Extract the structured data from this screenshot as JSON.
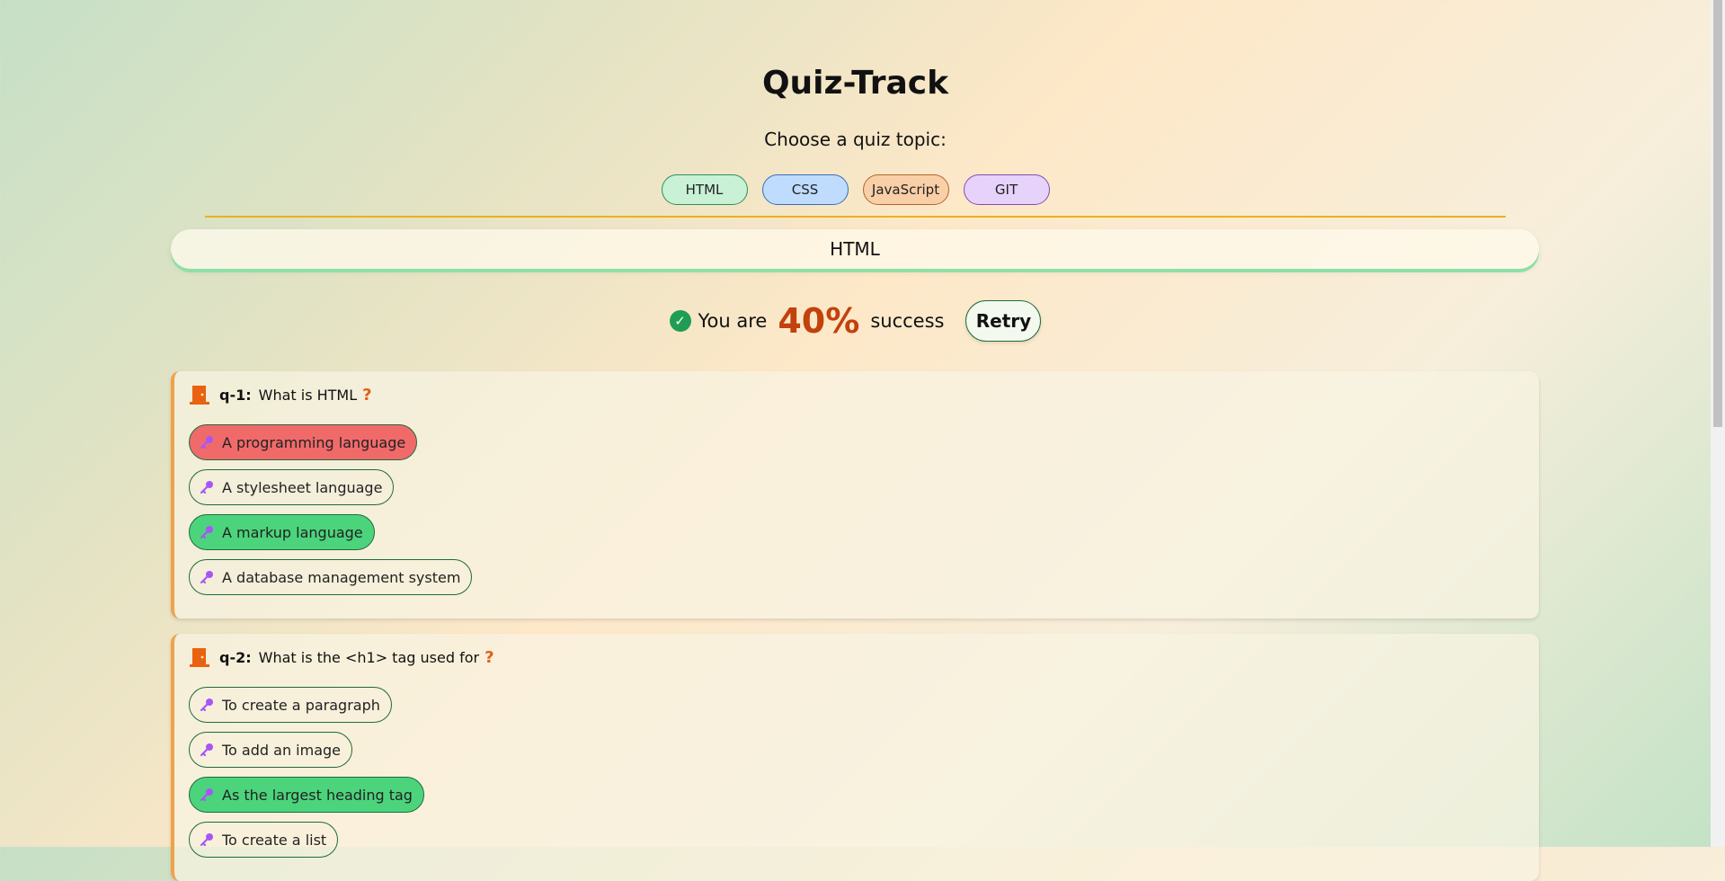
{
  "app": {
    "title": "Quiz-Track",
    "subtitle": "Choose a quiz topic:"
  },
  "topics": [
    {
      "label": "HTML"
    },
    {
      "label": "CSS"
    },
    {
      "label": "JavaScript"
    },
    {
      "label": "GIT"
    }
  ],
  "current_topic": "HTML",
  "score": {
    "prefix": "You are",
    "percent": "40%",
    "suffix": "success",
    "retry_label": "Retry"
  },
  "questions": [
    {
      "label": "q-1:",
      "text": "What is HTML",
      "mark": "?",
      "options": [
        {
          "text": "A programming language",
          "state": "wrong"
        },
        {
          "text": "A stylesheet language",
          "state": "none"
        },
        {
          "text": "A markup language",
          "state": "correct"
        },
        {
          "text": "A database management system",
          "state": "none"
        }
      ]
    },
    {
      "label": "q-2:",
      "text": "What is the <h1> tag used for",
      "mark": "?",
      "options": [
        {
          "text": "To create a paragraph",
          "state": "none"
        },
        {
          "text": "To add an image",
          "state": "none"
        },
        {
          "text": "As the largest heading tag",
          "state": "correct"
        },
        {
          "text": "To create a list",
          "state": "none"
        }
      ]
    }
  ],
  "colors": {
    "accent": "#c2410c",
    "correct": "#4cd47c",
    "wrong": "#f16a6a",
    "divider": "#e8b21c"
  }
}
